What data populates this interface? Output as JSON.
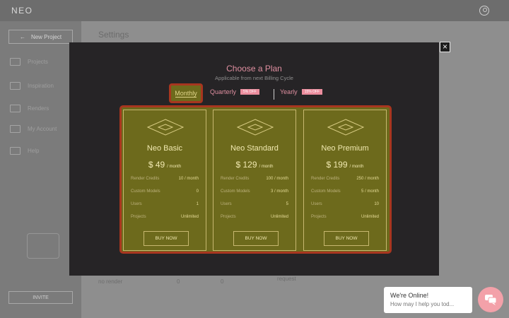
{
  "app": {
    "logo": "NEO"
  },
  "sidebar": {
    "new_project": "New Project",
    "items": [
      {
        "label": "Projects",
        "icon": "projects-icon"
      },
      {
        "label": "Inspiration",
        "icon": "book-icon"
      },
      {
        "label": "Renders",
        "icon": "image-icon"
      },
      {
        "label": "My Account",
        "icon": "user-icon"
      },
      {
        "label": "Help",
        "icon": "mail-icon"
      }
    ],
    "invite": "INVITE"
  },
  "main": {
    "title": "Settings",
    "row_cells": [
      "no render",
      "0",
      "0",
      "request"
    ]
  },
  "modal": {
    "title": "Choose a Plan",
    "subtitle": "Applicable from next Billing Cycle",
    "close": "×",
    "tabs": [
      {
        "label": "Monthly",
        "badge": "",
        "active": true
      },
      {
        "label": "Quarterly",
        "badge": "5% OFF",
        "active": false
      },
      {
        "label": "Yearly",
        "badge": "15% OFF",
        "active": false
      }
    ],
    "plans": [
      {
        "name": "Neo Basic",
        "price": "$ 49",
        "per": "/ month",
        "features": [
          {
            "label": "Render Credits",
            "value": "10 / month"
          },
          {
            "label": "Custom Models",
            "value": "0"
          },
          {
            "label": "Users",
            "value": "1"
          },
          {
            "label": "Projects",
            "value": "Unlimited"
          }
        ],
        "button": "BUY NOW"
      },
      {
        "name": "Neo Standard",
        "price": "$ 129",
        "per": "/ month",
        "features": [
          {
            "label": "Render Credits",
            "value": "100 / month"
          },
          {
            "label": "Custom Models",
            "value": "3 / month"
          },
          {
            "label": "Users",
            "value": "5"
          },
          {
            "label": "Projects",
            "value": "Unlimited"
          }
        ],
        "button": "BUY NOW"
      },
      {
        "name": "Neo Premium",
        "price": "$ 199",
        "per": "/ month",
        "features": [
          {
            "label": "Render Credits",
            "value": "250 / month"
          },
          {
            "label": "Custom Models",
            "value": "5 / month"
          },
          {
            "label": "Users",
            "value": "10"
          },
          {
            "label": "Projects",
            "value": "Unlimited"
          }
        ],
        "button": "BUY NOW"
      }
    ]
  },
  "chat": {
    "title": "We're Online!",
    "subtitle": "How may I help you tod..."
  },
  "colors": {
    "accent_pink": "#df8fa0",
    "card_olive": "#6d6a1c",
    "highlight_border": "#a8361f",
    "modal_bg": "#262426"
  }
}
